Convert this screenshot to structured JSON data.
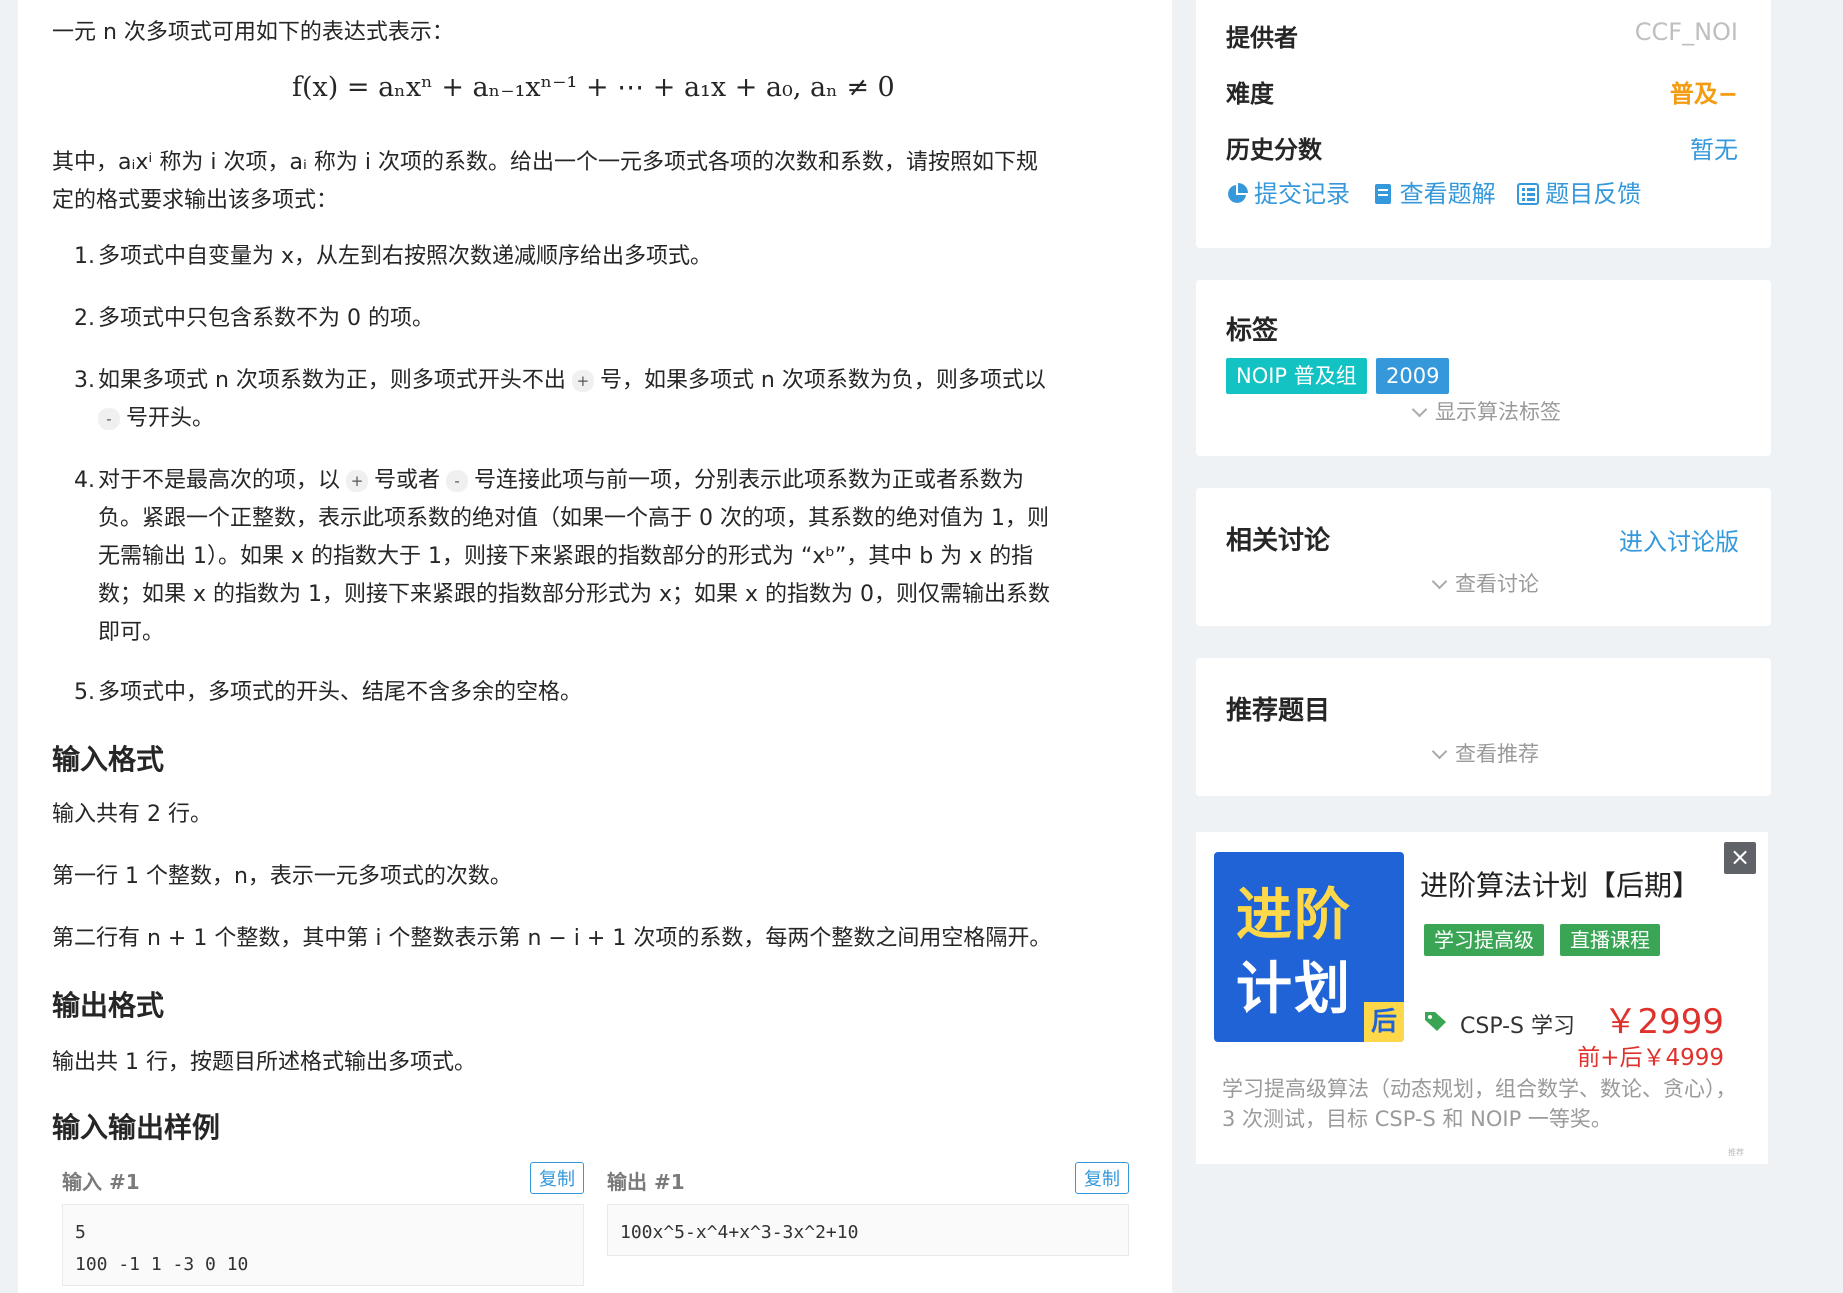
{
  "problem": {
    "intro": "一元 n 次多项式可用如下的表达式表示：",
    "formula": "f(x) = aₙxⁿ + aₙ₋₁xⁿ⁻¹ + ⋯ + a₁x + a₀, aₙ ≠ 0",
    "explain_line1": "其中，aᵢxⁱ 称为 i 次项，aᵢ 称为 i 次项的系数。给出一个一元多项式各项的次数和系数，请按照如下规",
    "explain_line2": "定的格式要求输出该多项式：",
    "rules": [
      {
        "num": "1.",
        "lines": [
          "多项式中自变量为 x，从左到右按照次数递减顺序给出多项式。"
        ]
      },
      {
        "num": "2.",
        "lines": [
          "多项式中只包含系数不为 0 的项。"
        ]
      },
      {
        "num": "3.",
        "line1_a": "如果多项式 n 次项系数为正，则多项式开头不出",
        "plus": "+",
        "line1_b": "号，如果多项式 n 次项系数为负，则多项式以",
        "minus": "-",
        "line2_b": "号开头。"
      },
      {
        "num": "4.",
        "line1_a": "对于不是最高次的项，以",
        "plus": "+",
        "line1_b": "号或者",
        "minus": "-",
        "line1_c": "号连接此项与前一项，分别表示此项系数为正或者系数为",
        "lines": [
          "负。紧跟一个正整数，表示此项系数的绝对值（如果一个高于 0 次的项，其系数的绝对值为 1，则",
          "无需输出 1）。如果 x 的指数大于 1，则接下来紧跟的指数部分的形式为 “xᵇ”，其中 b 为 x 的指",
          "数；如果 x 的指数为 1，则接下来紧跟的指数部分形式为 x；如果 x 的指数为 0，则仅需输出系数",
          "即可。"
        ]
      },
      {
        "num": "5.",
        "lines": [
          "多项式中，多项式的开头、结尾不含多余的空格。"
        ]
      }
    ],
    "input_heading": "输入格式",
    "input_lines": [
      "输入共有 2 行。",
      "第一行 1 个整数，n，表示一元多项式的次数。",
      "第二行有 n + 1 个整数，其中第 i 个整数表示第 n − i + 1 次项的系数，每两个整数之间用空格隔开。"
    ],
    "output_heading": "输出格式",
    "output_lines": [
      "输出共 1 行，按题目所述格式输出多项式。"
    ],
    "samples_heading": "输入输出样例",
    "sample_in_label": "输入 #1",
    "sample_out_label": "输出 #1",
    "copy_label": "复制",
    "sample_in": "5\n100 -1 1 -3 0 10",
    "sample_out": "100x^5-x^4+x^3-3x^2+10"
  },
  "sidebar": {
    "provider_label": "提供者",
    "provider_value": "CCF_NOI",
    "difficulty_label": "难度",
    "difficulty_value": "普及−",
    "history_label": "历史分数",
    "history_value": "暂无",
    "links": [
      "提交记录",
      "查看题解",
      "题目反馈"
    ],
    "tags_title": "标签",
    "tags": [
      {
        "label": "NOIP 普及组",
        "color": "#13c2c2"
      },
      {
        "label": "2009",
        "color": "#3498db"
      }
    ],
    "show_algo_tags": "显示算法标签",
    "discussion_title": "相关讨论",
    "discussion_link": "进入讨论版",
    "view_discussion": "查看讨论",
    "recommend_title": "推荐题目",
    "view_recommend": "查看推荐"
  },
  "ad": {
    "image_line1": "进阶",
    "image_line2": "计划",
    "image_corner": "后",
    "close": "×",
    "title": "进阶算法计划【后期】",
    "badges": [
      "学习提高级",
      "直播课程"
    ],
    "course": "CSP-S 学习",
    "price": "￥2999",
    "price2": "前+后￥4999",
    "desc": "学习提高级算法（动态规划，组合数学、数论、贪心），3 次测试，目标 CSP-S 和 NOIP 一等奖。",
    "mini": "推荐"
  },
  "colors": {
    "link": "#3498db",
    "difficulty": "#f39c11",
    "provider": "#bfbfbf",
    "price": "#e0322d"
  }
}
